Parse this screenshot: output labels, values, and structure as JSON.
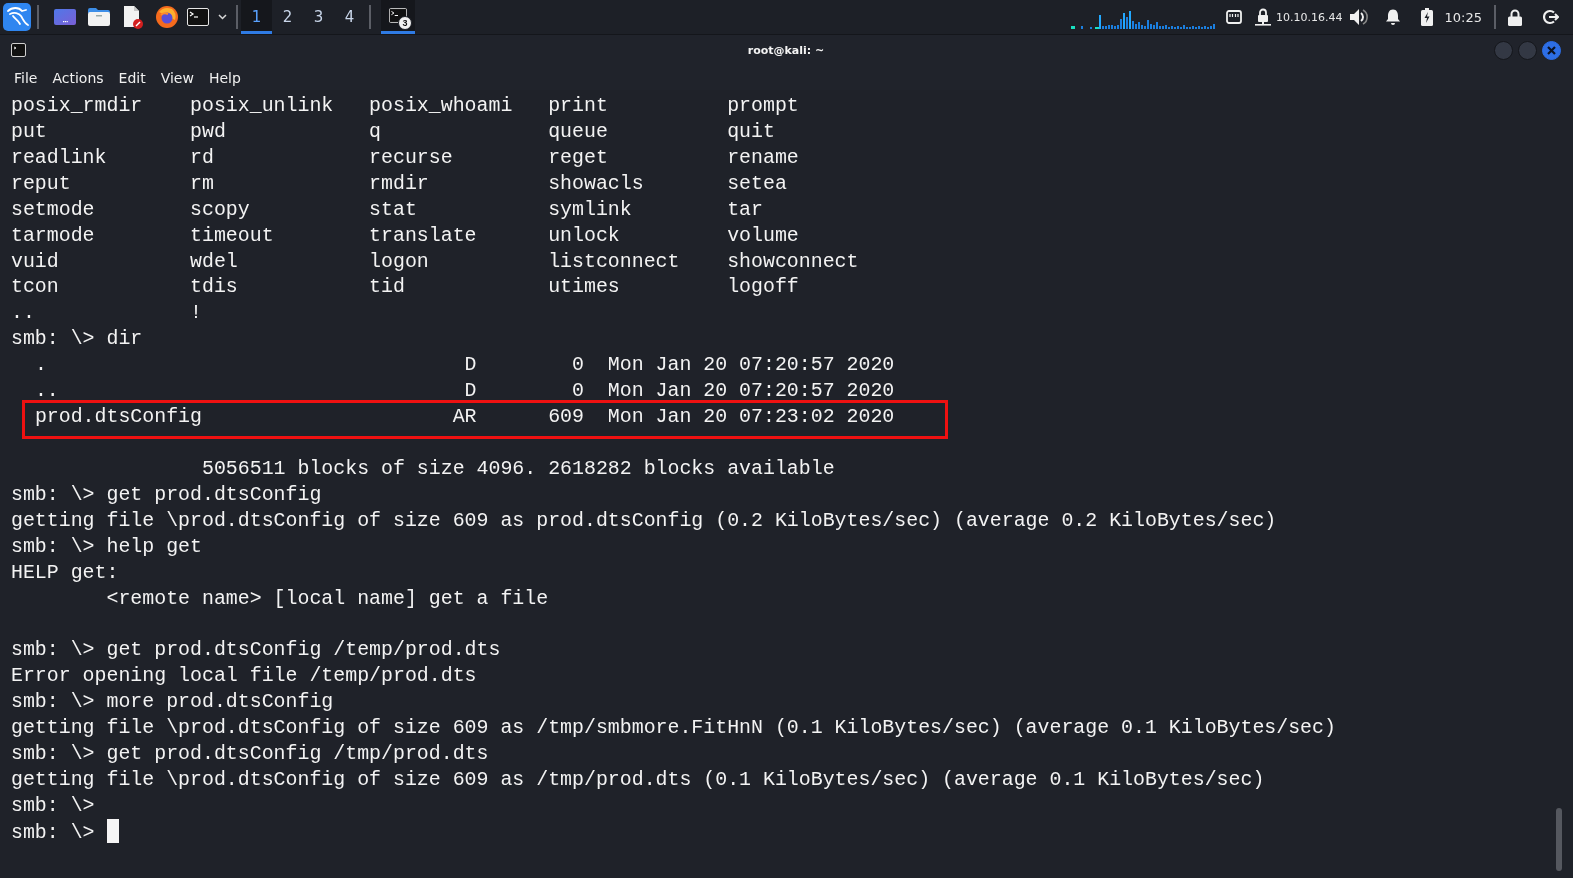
{
  "taskbar": {
    "workspaces": [
      {
        "label": "1",
        "selected": true
      },
      {
        "label": "2",
        "selected": false
      },
      {
        "label": "3",
        "selected": false
      },
      {
        "label": "4",
        "selected": false
      }
    ],
    "tasks": [
      {
        "badge": "3",
        "selected": true
      }
    ],
    "vpn_address": "10.10.16.44",
    "clock": "10:25"
  },
  "window": {
    "title": "root@kali: ~"
  },
  "menu": [
    "File",
    "Actions",
    "Edit",
    "View",
    "Help"
  ],
  "terminal": {
    "lines": [
      {
        "kind": "line",
        "text": "posix_rmdir    posix_unlink   posix_whoami   print          prompt"
      },
      {
        "kind": "line",
        "text": "put            pwd            q              queue          quit"
      },
      {
        "kind": "line",
        "text": "readlink       rd             recurse        reget          rename"
      },
      {
        "kind": "line",
        "text": "reput          rm             rmdir          showacls       setea"
      },
      {
        "kind": "line",
        "text": "setmode        scopy          stat           symlink        tar"
      },
      {
        "kind": "line",
        "text": "tarmode        timeout        translate      unlock         volume"
      },
      {
        "kind": "line",
        "text": "vuid           wdel           logon          listconnect    showconnect"
      },
      {
        "kind": "line",
        "text": "tcon           tdis           tid            utimes         logoff"
      },
      {
        "kind": "line",
        "text": "..             !"
      },
      {
        "kind": "line",
        "text": "smb: \\> dir"
      },
      {
        "kind": "line",
        "text": "  .                                   D        0  Mon Jan 20 07:20:57 2020"
      },
      {
        "kind": "line",
        "text": "  ..                                  D        0  Mon Jan 20 07:20:57 2020"
      },
      {
        "kind": "boxed",
        "text": "  prod.dtsConfig                     AR      609  Mon Jan 20 07:23:02 2020"
      },
      {
        "kind": "blank"
      },
      {
        "kind": "line",
        "text": "                5056511 blocks of size 4096. 2618282 blocks available"
      },
      {
        "kind": "line",
        "text": "smb: \\> get prod.dtsConfig"
      },
      {
        "kind": "line",
        "text": "getting file \\prod.dtsConfig of size 609 as prod.dtsConfig (0.2 KiloBytes/sec) (average 0.2 KiloBytes/sec)"
      },
      {
        "kind": "line",
        "text": "smb: \\> help get"
      },
      {
        "kind": "line",
        "text": "HELP get:"
      },
      {
        "kind": "line",
        "text": "        <remote name> [local name] get a file"
      },
      {
        "kind": "blank"
      },
      {
        "kind": "line",
        "text": "smb: \\> get prod.dtsConfig /temp/prod.dts"
      },
      {
        "kind": "line",
        "text": "Error opening local file /temp/prod.dts"
      },
      {
        "kind": "line",
        "text": "smb: \\> more prod.dtsConfig"
      },
      {
        "kind": "line",
        "text": "getting file \\prod.dtsConfig of size 609 as /tmp/smbmore.FitHnN (0.1 KiloBytes/sec) (average 0.1 KiloBytes/sec)"
      },
      {
        "kind": "line",
        "text": "smb: \\> get prod.dtsConfig /tmp/prod.dts"
      },
      {
        "kind": "line",
        "text": "getting file \\prod.dtsConfig of size 609 as /tmp/prod.dts (0.1 KiloBytes/sec) (average 0.1 KiloBytes/sec)"
      },
      {
        "kind": "line",
        "text": "smb: \\>"
      },
      {
        "kind": "line",
        "text": "smb: \\>"
      }
    ],
    "cursor": true
  }
}
